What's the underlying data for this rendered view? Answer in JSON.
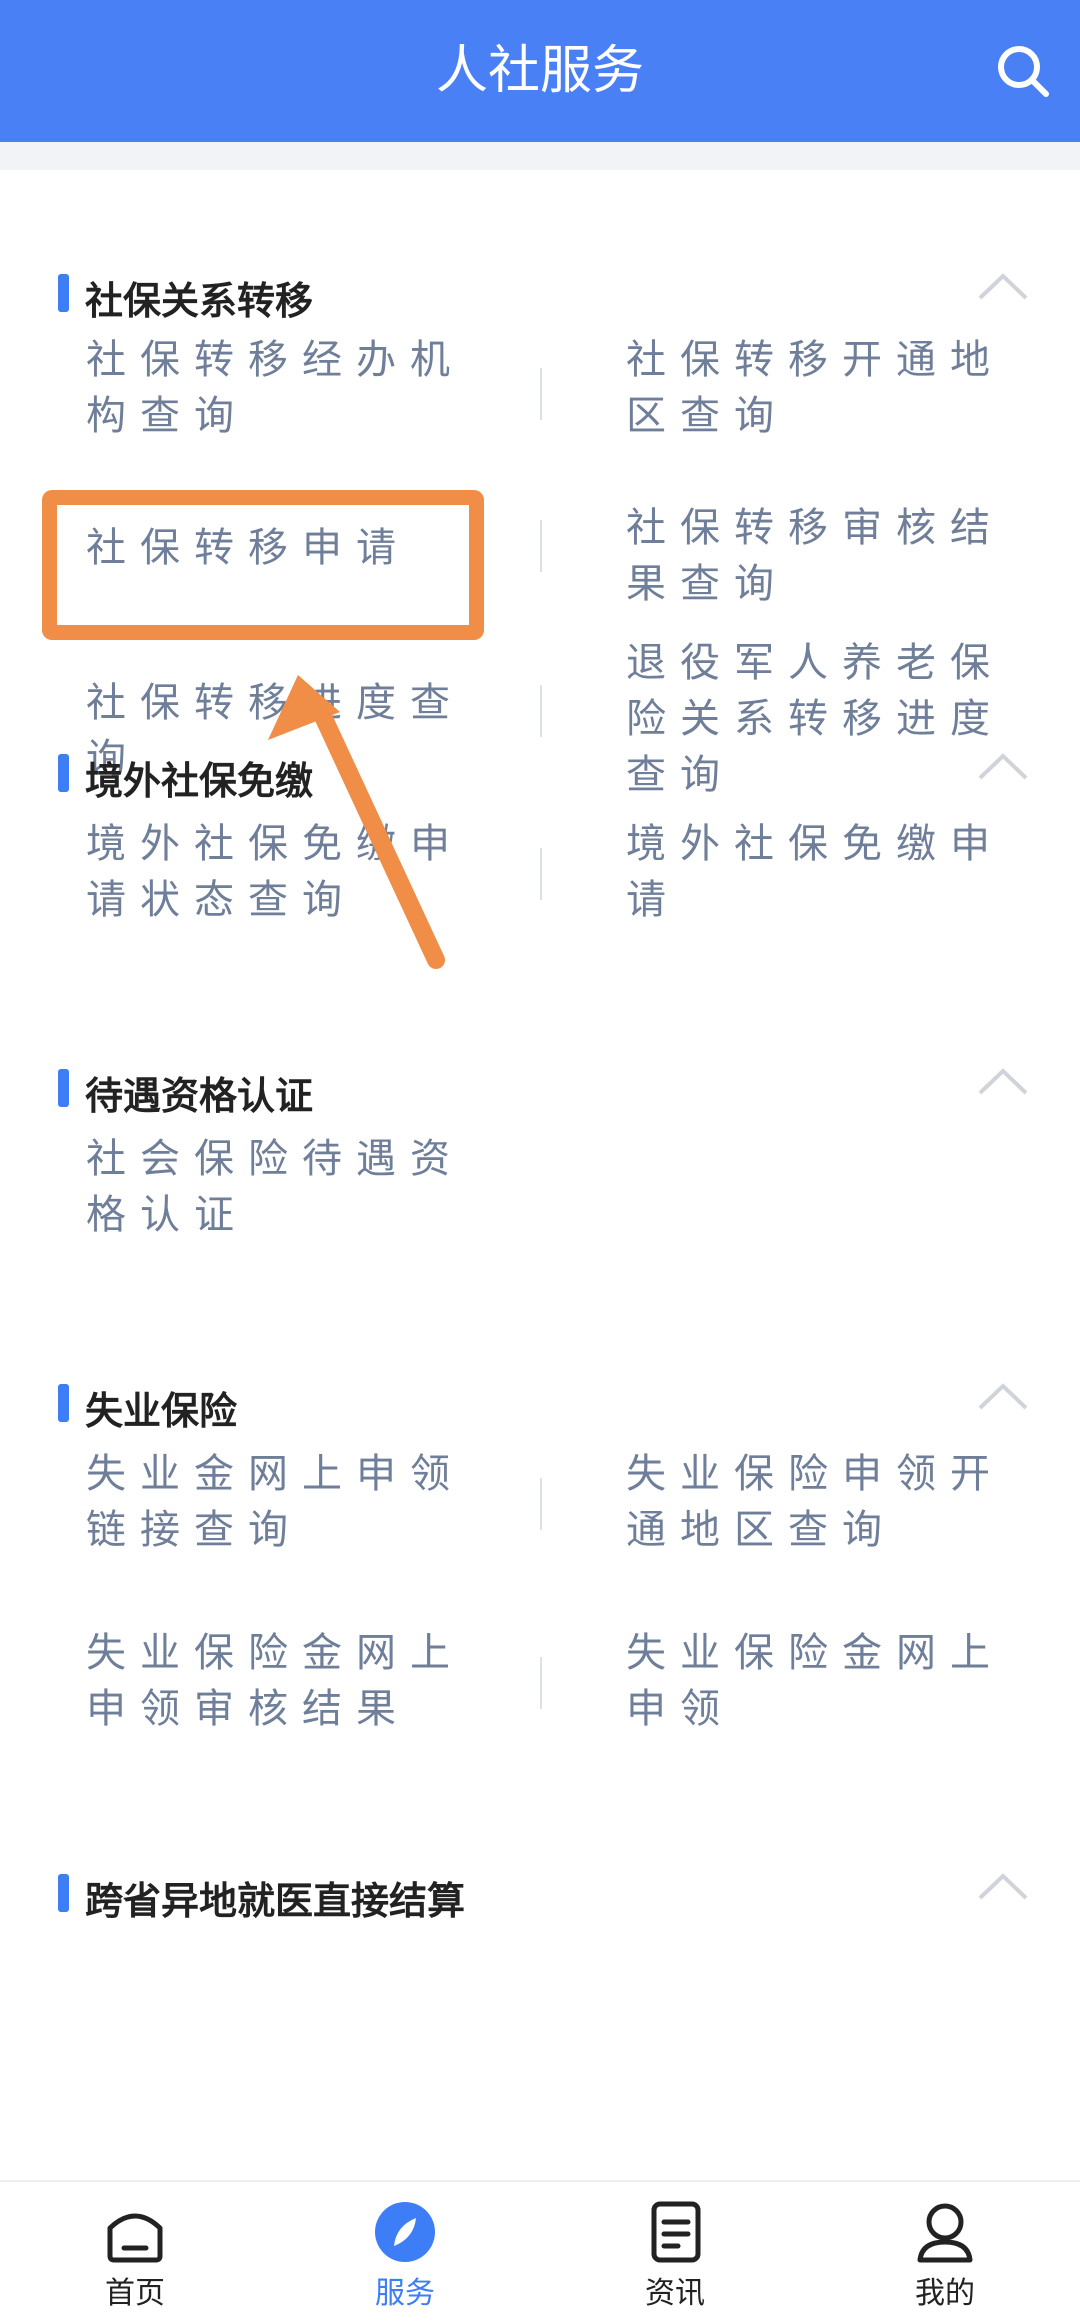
{
  "header": {
    "title": "人社服务",
    "search_icon": "search-icon"
  },
  "sections": [
    {
      "title": "社保关系转移",
      "rows": [
        [
          "社保转移经办机构查询",
          "社保转移开通地区查询"
        ],
        [
          "社保转移申请",
          "社保转移审核结果查询"
        ],
        [
          "社保转移进度查询",
          "退役军人养老保险关系转移进度查询"
        ]
      ]
    },
    {
      "title": "境外社保免缴",
      "rows": [
        [
          "境外社保免缴申请状态查询",
          "境外社保免缴申请"
        ]
      ]
    },
    {
      "title": "待遇资格认证",
      "rows": [
        [
          "社会保险待遇资格认证",
          ""
        ]
      ]
    },
    {
      "title": "失业保险",
      "rows": [
        [
          "失业金网上申领链接查询",
          "失业保险申领开通地区查询"
        ],
        [
          "失业保险金网上申领审核结果",
          "失业保险金网上申领"
        ]
      ]
    },
    {
      "title": "跨省异地就医直接结算",
      "rows": []
    }
  ],
  "tabbar": {
    "items": [
      {
        "label": "首页",
        "icon": "home-icon"
      },
      {
        "label": "服务",
        "icon": "compass-icon",
        "active": true
      },
      {
        "label": "资讯",
        "icon": "news-icon"
      },
      {
        "label": "我的",
        "icon": "user-icon"
      }
    ]
  },
  "colors": {
    "header_bg": "#4a80f5",
    "accent": "#3d7df5",
    "highlight": "#f08d46",
    "item_text": "#6f7e99"
  }
}
